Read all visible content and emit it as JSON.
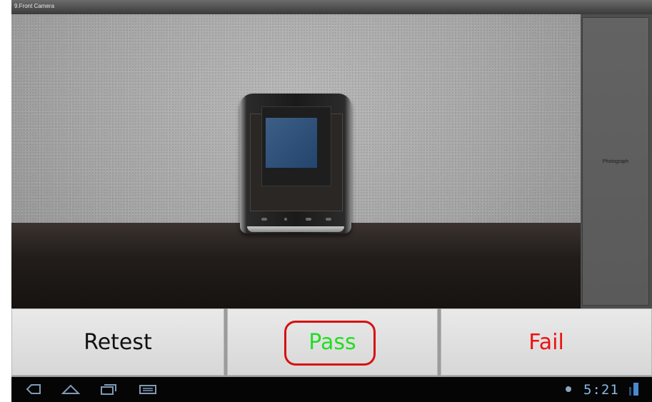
{
  "window": {
    "title": "9.Front Camera"
  },
  "camera": {
    "photograph_label": "Photograph"
  },
  "actions": {
    "retest_label": "Retest",
    "pass_label": "Pass",
    "fail_label": "Fail",
    "retest_color": "#111111",
    "pass_color": "#22dd22",
    "fail_color": "#ee1111"
  },
  "status_bar": {
    "time": "5:21",
    "icons": [
      "back-icon",
      "home-icon",
      "recent-apps-icon",
      "keyboard-icon",
      "notification-icon",
      "signal-icon"
    ]
  },
  "colors": {
    "highlight_outline": "#d81010",
    "clock": "#8ab8e6"
  }
}
